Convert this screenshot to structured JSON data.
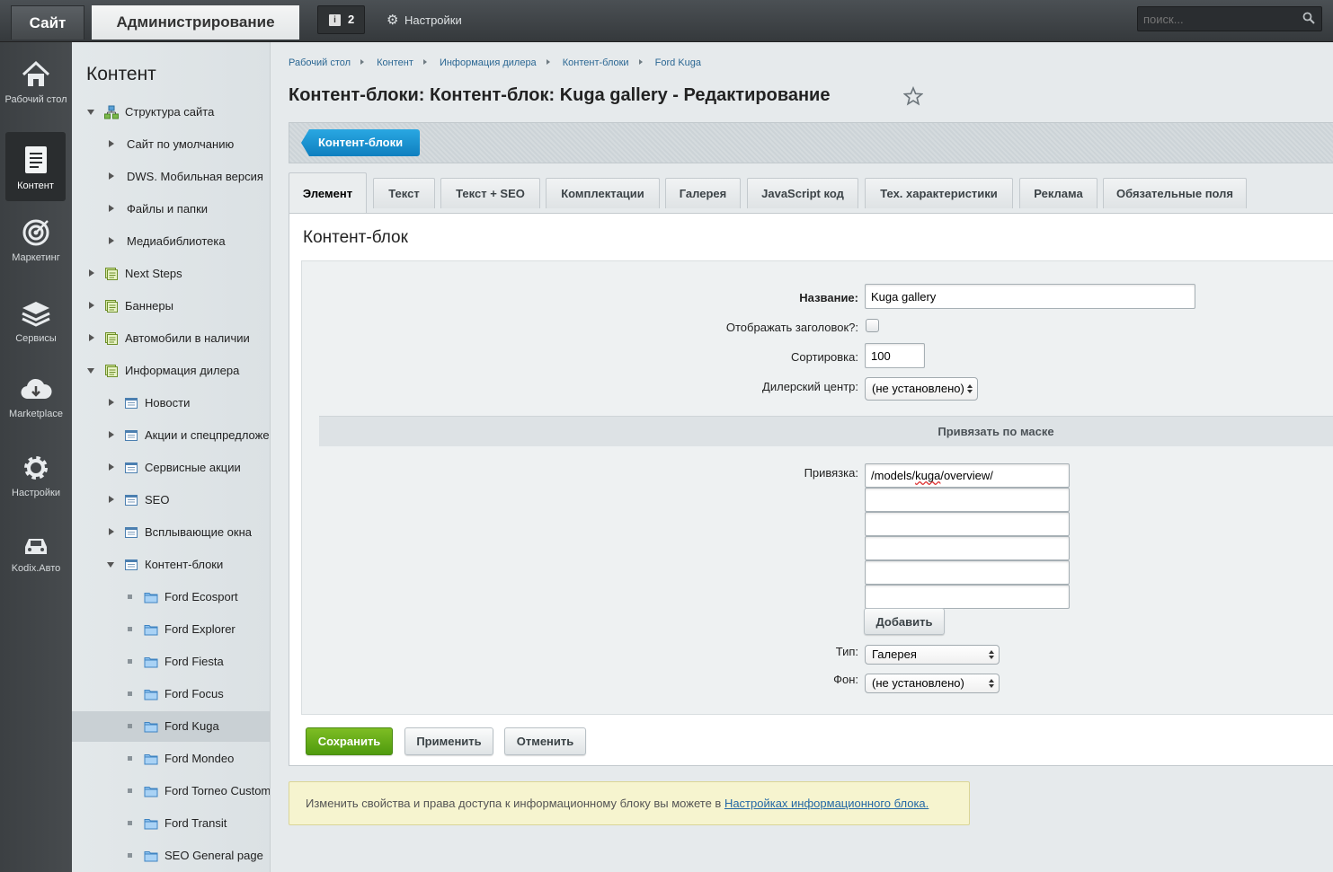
{
  "topbar": {
    "site_tab": "Сайт",
    "admin_tab": "Администрирование",
    "notifications_count": "2",
    "settings_label": "Настройки",
    "search_placeholder": "поиск..."
  },
  "leftnav": [
    {
      "label": "Рабочий стол",
      "icon": "home-icon"
    },
    {
      "label": "Контент",
      "icon": "document-icon",
      "active": true
    },
    {
      "label": "Маркетинг",
      "icon": "target-icon"
    },
    {
      "label": "Сервисы",
      "icon": "layers-icon"
    },
    {
      "label": "Marketplace",
      "icon": "cloud-download-icon"
    },
    {
      "label": "Настройки",
      "icon": "gear-icon"
    },
    {
      "label": "Kodix.Авто",
      "icon": "car-icon"
    }
  ],
  "tree": {
    "title": "Контент",
    "items": [
      {
        "label": "Структура сайта",
        "level": 0,
        "state": "expanded",
        "icon": "sitemap-icon"
      },
      {
        "label": "Сайт по умолчанию",
        "level": 1,
        "state": "collapsed"
      },
      {
        "label": "DWS. Мобильная версия",
        "level": 1,
        "state": "collapsed"
      },
      {
        "label": "Файлы и папки",
        "level": 1,
        "state": "collapsed"
      },
      {
        "label": "Медиабиблиотека",
        "level": 1,
        "state": "collapsed"
      },
      {
        "label": "Next Steps",
        "level": 0,
        "state": "collapsed",
        "icon": "iblock-type-icon"
      },
      {
        "label": "Баннеры",
        "level": 0,
        "state": "collapsed",
        "icon": "iblock-type-icon"
      },
      {
        "label": "Автомобили в наличии",
        "level": 0,
        "state": "collapsed",
        "icon": "iblock-type-icon"
      },
      {
        "label": "Информация дилера",
        "level": 0,
        "state": "expanded",
        "icon": "iblock-type-icon"
      },
      {
        "label": "Новости",
        "level": 1,
        "state": "collapsed",
        "icon": "iblock-icon"
      },
      {
        "label": "Акции и спецпредложения",
        "level": 1,
        "state": "collapsed",
        "icon": "iblock-icon"
      },
      {
        "label": "Сервисные акции",
        "level": 1,
        "state": "collapsed",
        "icon": "iblock-icon"
      },
      {
        "label": "SEO",
        "level": 1,
        "state": "collapsed",
        "icon": "iblock-icon"
      },
      {
        "label": "Всплывающие окна",
        "level": 1,
        "state": "collapsed",
        "icon": "iblock-icon"
      },
      {
        "label": "Контент-блоки",
        "level": 1,
        "state": "expanded",
        "icon": "iblock-icon"
      },
      {
        "label": "Ford Ecosport",
        "level": 2,
        "state": "leaf",
        "icon": "folder-icon"
      },
      {
        "label": "Ford Explorer",
        "level": 2,
        "state": "leaf",
        "icon": "folder-icon"
      },
      {
        "label": "Ford Fiesta",
        "level": 2,
        "state": "leaf",
        "icon": "folder-icon"
      },
      {
        "label": "Ford Focus",
        "level": 2,
        "state": "leaf",
        "icon": "folder-icon"
      },
      {
        "label": "Ford Kuga",
        "level": 2,
        "state": "leaf",
        "icon": "folder-icon",
        "selected": true
      },
      {
        "label": "Ford Mondeo",
        "level": 2,
        "state": "leaf",
        "icon": "folder-icon"
      },
      {
        "label": "Ford Torneo Custom",
        "level": 2,
        "state": "leaf",
        "icon": "folder-icon"
      },
      {
        "label": "Ford Transit",
        "level": 2,
        "state": "leaf",
        "icon": "folder-icon"
      },
      {
        "label": "SEO General page",
        "level": 2,
        "state": "leaf",
        "icon": "folder-icon"
      }
    ]
  },
  "breadcrumb": [
    "Рабочий стол",
    "Контент",
    "Информация дилера",
    "Контент-блоки",
    "Ford Kuga"
  ],
  "page_title": "Контент-блоки: Контент-блок: Kuga gallery - Редактирование",
  "context_button": "Контент-блоки",
  "tabs": [
    "Элемент",
    "Текст",
    "Текст + SEO",
    "Комплектации",
    "Галерея",
    "JavaScript код",
    "Тех. характеристики",
    "Реклама",
    "Обязательные поля"
  ],
  "active_tab": "Элемент",
  "panel_title": "Контент-блок",
  "form": {
    "name_label": "Название:",
    "name_value": "Kuga gallery",
    "show_title_label": "Отображать заголовок?:",
    "show_title_checked": false,
    "sort_label": "Сортировка:",
    "sort_value": "100",
    "dealer_label": "Дилерский центр:",
    "dealer_value": "(не установлено)",
    "mask_section": "Привязать по маске",
    "binding_label": "Привязка:",
    "binding_values": [
      "/models/kuga/overview/",
      "",
      "",
      "",
      "",
      ""
    ],
    "add_button": "Добавить",
    "type_label": "Тип:",
    "type_value": "Галерея",
    "bg_label": "Фон:",
    "bg_value": "(не установлено)"
  },
  "actions": {
    "save": "Сохранить",
    "apply": "Применить",
    "cancel": "Отменить"
  },
  "info": {
    "text": "Изменить свойства и права доступа к информационному блоку вы можете в ",
    "link": "Настройках информационного блока."
  },
  "colors": {
    "accent_blue": "#1a8fd2",
    "save_green": "#62ab18",
    "link": "#2468a5"
  }
}
